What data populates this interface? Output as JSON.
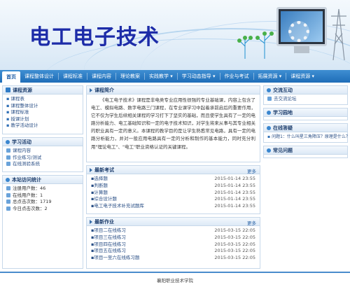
{
  "header": {
    "title": "电工电子技术"
  },
  "nav": {
    "items": [
      {
        "label": "首页"
      },
      {
        "label": "课程整体设计"
      },
      {
        "label": "课程标准"
      },
      {
        "label": "课程内容"
      },
      {
        "label": "理论教案"
      },
      {
        "label": "实践教学 ▾"
      },
      {
        "label": "学习动态指导 ▾"
      },
      {
        "label": "作业与考试"
      },
      {
        "label": "拓展资源 ▾"
      },
      {
        "label": "课程资源 ▾"
      }
    ]
  },
  "left": {
    "resources": {
      "title": "课程资源",
      "items": [
        "课程表",
        "课程整体设计",
        "课程标准",
        "授课计划",
        "教学活动设计"
      ]
    },
    "activities": {
      "title": "学习活动",
      "items": [
        "课程内容",
        "作业练习/测试",
        "在线测验系统"
      ]
    },
    "stats": {
      "title": "本站访问统计",
      "items": [
        "注册用户数：46",
        "在线用户数：1",
        "总点击次数：1719",
        "今日点击次数：2"
      ]
    }
  },
  "center": {
    "intro": {
      "title": "课程简介",
      "text": "《电工电子技术》课程是非电类专业应用性很强的专业基础课，内容上包含了电工、模拟电路、数字电路三门课程，在专业课学习中起着承前启后的重要作用，它不仅为学生后续相关课程的学习打下了坚实的基础，而且使学生具有了一定的电路分析能力、电工基础知识和一定的电子技术知识，对学生将来从事与其专业相关的职业具有一定的意义。本课程的教学目的是让学生熟悉常见电路，具有一定的电路分析能力，并对一般应用电路具有一定的分析和制作的基本能力，同时充分利用\"理论电工\"、\"电工\"职业资格认证的关键课程。"
    },
    "exams": {
      "title": "最新考试",
      "more": "更多",
      "rows": [
        {
          "name": "选择题",
          "date": "2015-01-14 23:55"
        },
        {
          "name": "判断题",
          "date": "2015-01-14 23:55"
        },
        {
          "name": "计算题",
          "date": "2015-01-14 23:55"
        },
        {
          "name": "综合设计题",
          "date": "2015-01-14 23:55"
        },
        {
          "name": "电工电子技术补充试题库",
          "date": "2015-01-14 23:55"
        }
      ]
    },
    "homework": {
      "title": "最新作业",
      "more": "更多",
      "rows": [
        {
          "name": "项目二在线练习",
          "date": "2015-03-15 22:05"
        },
        {
          "name": "项目三在线练习",
          "date": "2015-03-15 22:05"
        },
        {
          "name": "项目四在线练习",
          "date": "2015-03-15 22:05"
        },
        {
          "name": "项目五在线练习",
          "date": "2015-03-15 22:05"
        },
        {
          "name": "项目一至六在线练习题",
          "date": "2015-03-15 22:05"
        }
      ]
    }
  },
  "right": {
    "interact": {
      "title": "交流互动",
      "link": "去交流论坛"
    },
    "learning": {
      "title": "学习园地"
    },
    "qa": {
      "title": "在线答疑",
      "item": "问题1：什么叫星三角降压？原理是什么？"
    },
    "faq": {
      "title": "常见问题"
    }
  },
  "footer": {
    "text": "襄阳职业技术学院"
  },
  "colors": {
    "nav": "#1f6db8",
    "title": "#1d2ca8",
    "panel_border": "#c7d8ea"
  }
}
